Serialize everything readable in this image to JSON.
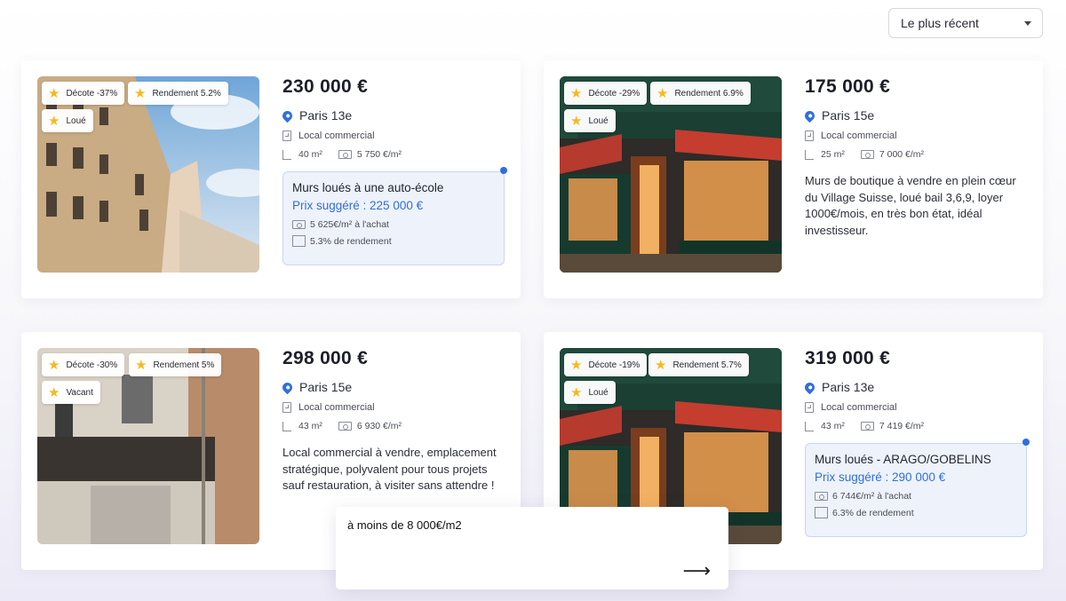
{
  "sort": {
    "label": "Le plus récent"
  },
  "listings": [
    {
      "badges": [
        "Décote -37%",
        "Rendement 5.2%",
        "Loué"
      ],
      "price": "230 000 €",
      "location": "Paris 13e",
      "type": "Local commercial",
      "area": "40 m²",
      "price_per_m2": "5 750 €/m²",
      "note": {
        "title": "Murs loués à une auto-école",
        "suggested": "Prix suggéré : 225 000 €",
        "purchase": "5 625€/m² à l'achat",
        "yield": "5.3% de rendement"
      }
    },
    {
      "badges": [
        "Décote -29%",
        "Rendement 6.9%",
        "Loué"
      ],
      "price": "175 000 €",
      "location": "Paris 15e",
      "type": "Local commercial",
      "area": "25 m²",
      "price_per_m2": "7 000 €/m²",
      "description": "Murs de boutique à vendre en plein cœur du Village Suisse, loué bail 3,6,9, loyer 1000€/mois, en très bon état, idéal investisseur."
    },
    {
      "badges": [
        "Décote -30%",
        "Rendement 5%",
        "Vacant"
      ],
      "price": "298 000 €",
      "location": "Paris 15e",
      "type": "Local commercial",
      "area": "43 m²",
      "price_per_m2": "6 930 €/m²",
      "description": "Local commercial à vendre, emplacement stratégique, polyvalent pour tous projets sauf restauration, à visiter sans attendre !"
    },
    {
      "badges": [
        "Décote -19%",
        "Rendement 5.7%",
        "Loué"
      ],
      "price": "319 000 €",
      "location": "Paris 13e",
      "type": "Local commercial",
      "area": "43 m²",
      "price_per_m2": "7 419 €/m²",
      "note": {
        "title": "Murs loués - ARAGO/GOBELINS",
        "suggested": "Prix suggéré : 290 000 €",
        "purchase": "6 744€/m² à l'achat",
        "yield": "6.3% de rendement"
      }
    }
  ],
  "query": {
    "text": "à moins de 8 000€/m2",
    "send_icon": "arrow-right-icon"
  }
}
